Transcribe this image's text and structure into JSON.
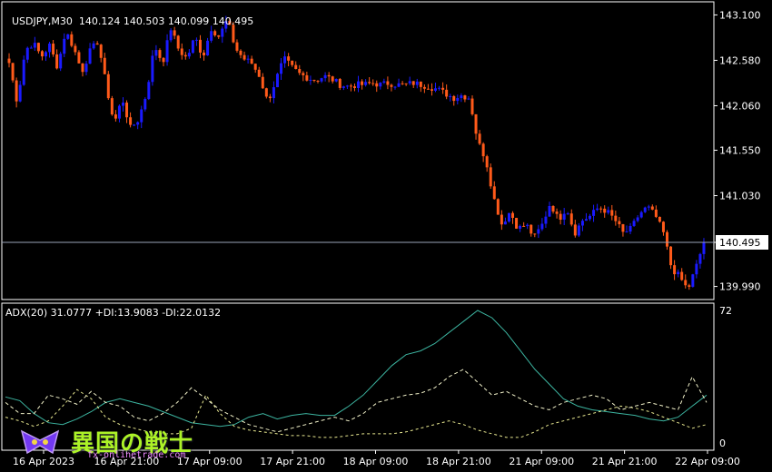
{
  "header": {
    "symbol": "USDJPY,M30",
    "ohlc": "140.124 140.503 140.099 140.495",
    "indicator": "ADX(20) 31.0777 +DI:13.9083 -DI:22.0132"
  },
  "watermark": {
    "text": "異国の戦士",
    "url": "fx-onlinetrade.com"
  },
  "colors": {
    "up": "#1a1aff",
    "down": "#ff5a1a",
    "adx": "#3cb4a0",
    "pdi": "#e8e890",
    "mdi": "#f0f0c8",
    "grid": "#ffffff"
  },
  "chart_data": [
    {
      "type": "candlestick",
      "title": "USDJPY,M30",
      "ylim": [
        139.84,
        143.25
      ],
      "y_ticks": [
        "143.100",
        "142.580",
        "142.060",
        "141.550",
        "141.030",
        "140.495",
        "139.990"
      ],
      "y_tick_values": [
        143.1,
        142.58,
        142.06,
        141.55,
        141.03,
        140.495,
        139.99
      ],
      "current_price": 140.495,
      "x_ticks": [
        "16 Apr 2023",
        "16 Apr 21:00",
        "17 Apr 09:00",
        "17 Apr 21:00",
        "18 Apr 09:00",
        "18 Apr 21:00",
        "21 Apr 09:00",
        "21 Apr 21:00",
        "22 Apr 09:00"
      ],
      "close_path": [
        142.55,
        142.1,
        142.7,
        142.78,
        142.62,
        142.75,
        142.5,
        142.92,
        142.72,
        142.45,
        142.68,
        142.8,
        142.3,
        141.85,
        142.15,
        141.8,
        141.9,
        142.2,
        142.75,
        142.55,
        142.95,
        142.7,
        142.6,
        142.85,
        142.62,
        142.95,
        142.85,
        143.05,
        142.72,
        142.6,
        142.55,
        142.4,
        142.1,
        142.35,
        142.6,
        142.5,
        142.42,
        142.38,
        142.35,
        142.4,
        142.36,
        142.3,
        142.28,
        142.3,
        142.3,
        142.32,
        142.3,
        142.32,
        142.3,
        142.3,
        142.32,
        142.3,
        142.28,
        142.25,
        142.2,
        142.15,
        142.18,
        142.15,
        141.65,
        141.45,
        141.0,
        140.7,
        140.85,
        140.65,
        140.7,
        140.55,
        140.7,
        140.95,
        140.75,
        140.9,
        140.6,
        140.75,
        140.8,
        140.9,
        140.85,
        140.75,
        140.6,
        140.65,
        140.82,
        140.9,
        140.8,
        140.6,
        140.2,
        140.1,
        139.95,
        140.2,
        140.495
      ],
      "adx_ylim": [
        0,
        72
      ],
      "adx_ticks": [
        "72",
        "0"
      ],
      "series": [
        {
          "name": "ADX",
          "values": [
            25,
            23,
            16,
            11,
            10,
            13,
            17,
            22,
            24,
            22,
            20,
            17,
            14,
            11,
            10,
            9,
            10,
            14,
            16,
            13,
            15,
            16,
            15,
            15,
            20,
            26,
            34,
            42,
            48,
            50,
            54,
            60,
            66,
            72,
            68,
            60,
            50,
            40,
            32,
            24,
            20,
            18,
            17,
            16,
            15,
            13,
            12,
            14,
            20,
            26
          ]
        },
        {
          "name": "+DI",
          "values": [
            14,
            12,
            9,
            12,
            20,
            29,
            24,
            14,
            10,
            8,
            6,
            5,
            5,
            8,
            26,
            16,
            9,
            7,
            6,
            5,
            4,
            4,
            3,
            3,
            4,
            5,
            5,
            5,
            6,
            8,
            10,
            12,
            10,
            7,
            5,
            3,
            3,
            6,
            10,
            12,
            14,
            16,
            18,
            20,
            19,
            17,
            14,
            11,
            8,
            10
          ]
        },
        {
          "name": "-DI",
          "values": [
            22,
            16,
            16,
            26,
            24,
            21,
            28,
            22,
            20,
            14,
            12,
            16,
            22,
            30,
            24,
            18,
            14,
            10,
            8,
            6,
            8,
            10,
            12,
            14,
            12,
            16,
            22,
            24,
            26,
            27,
            30,
            36,
            40,
            33,
            26,
            28,
            24,
            20,
            18,
            22,
            24,
            26,
            24,
            18,
            20,
            22,
            20,
            18,
            36,
            22
          ]
        }
      ]
    }
  ]
}
